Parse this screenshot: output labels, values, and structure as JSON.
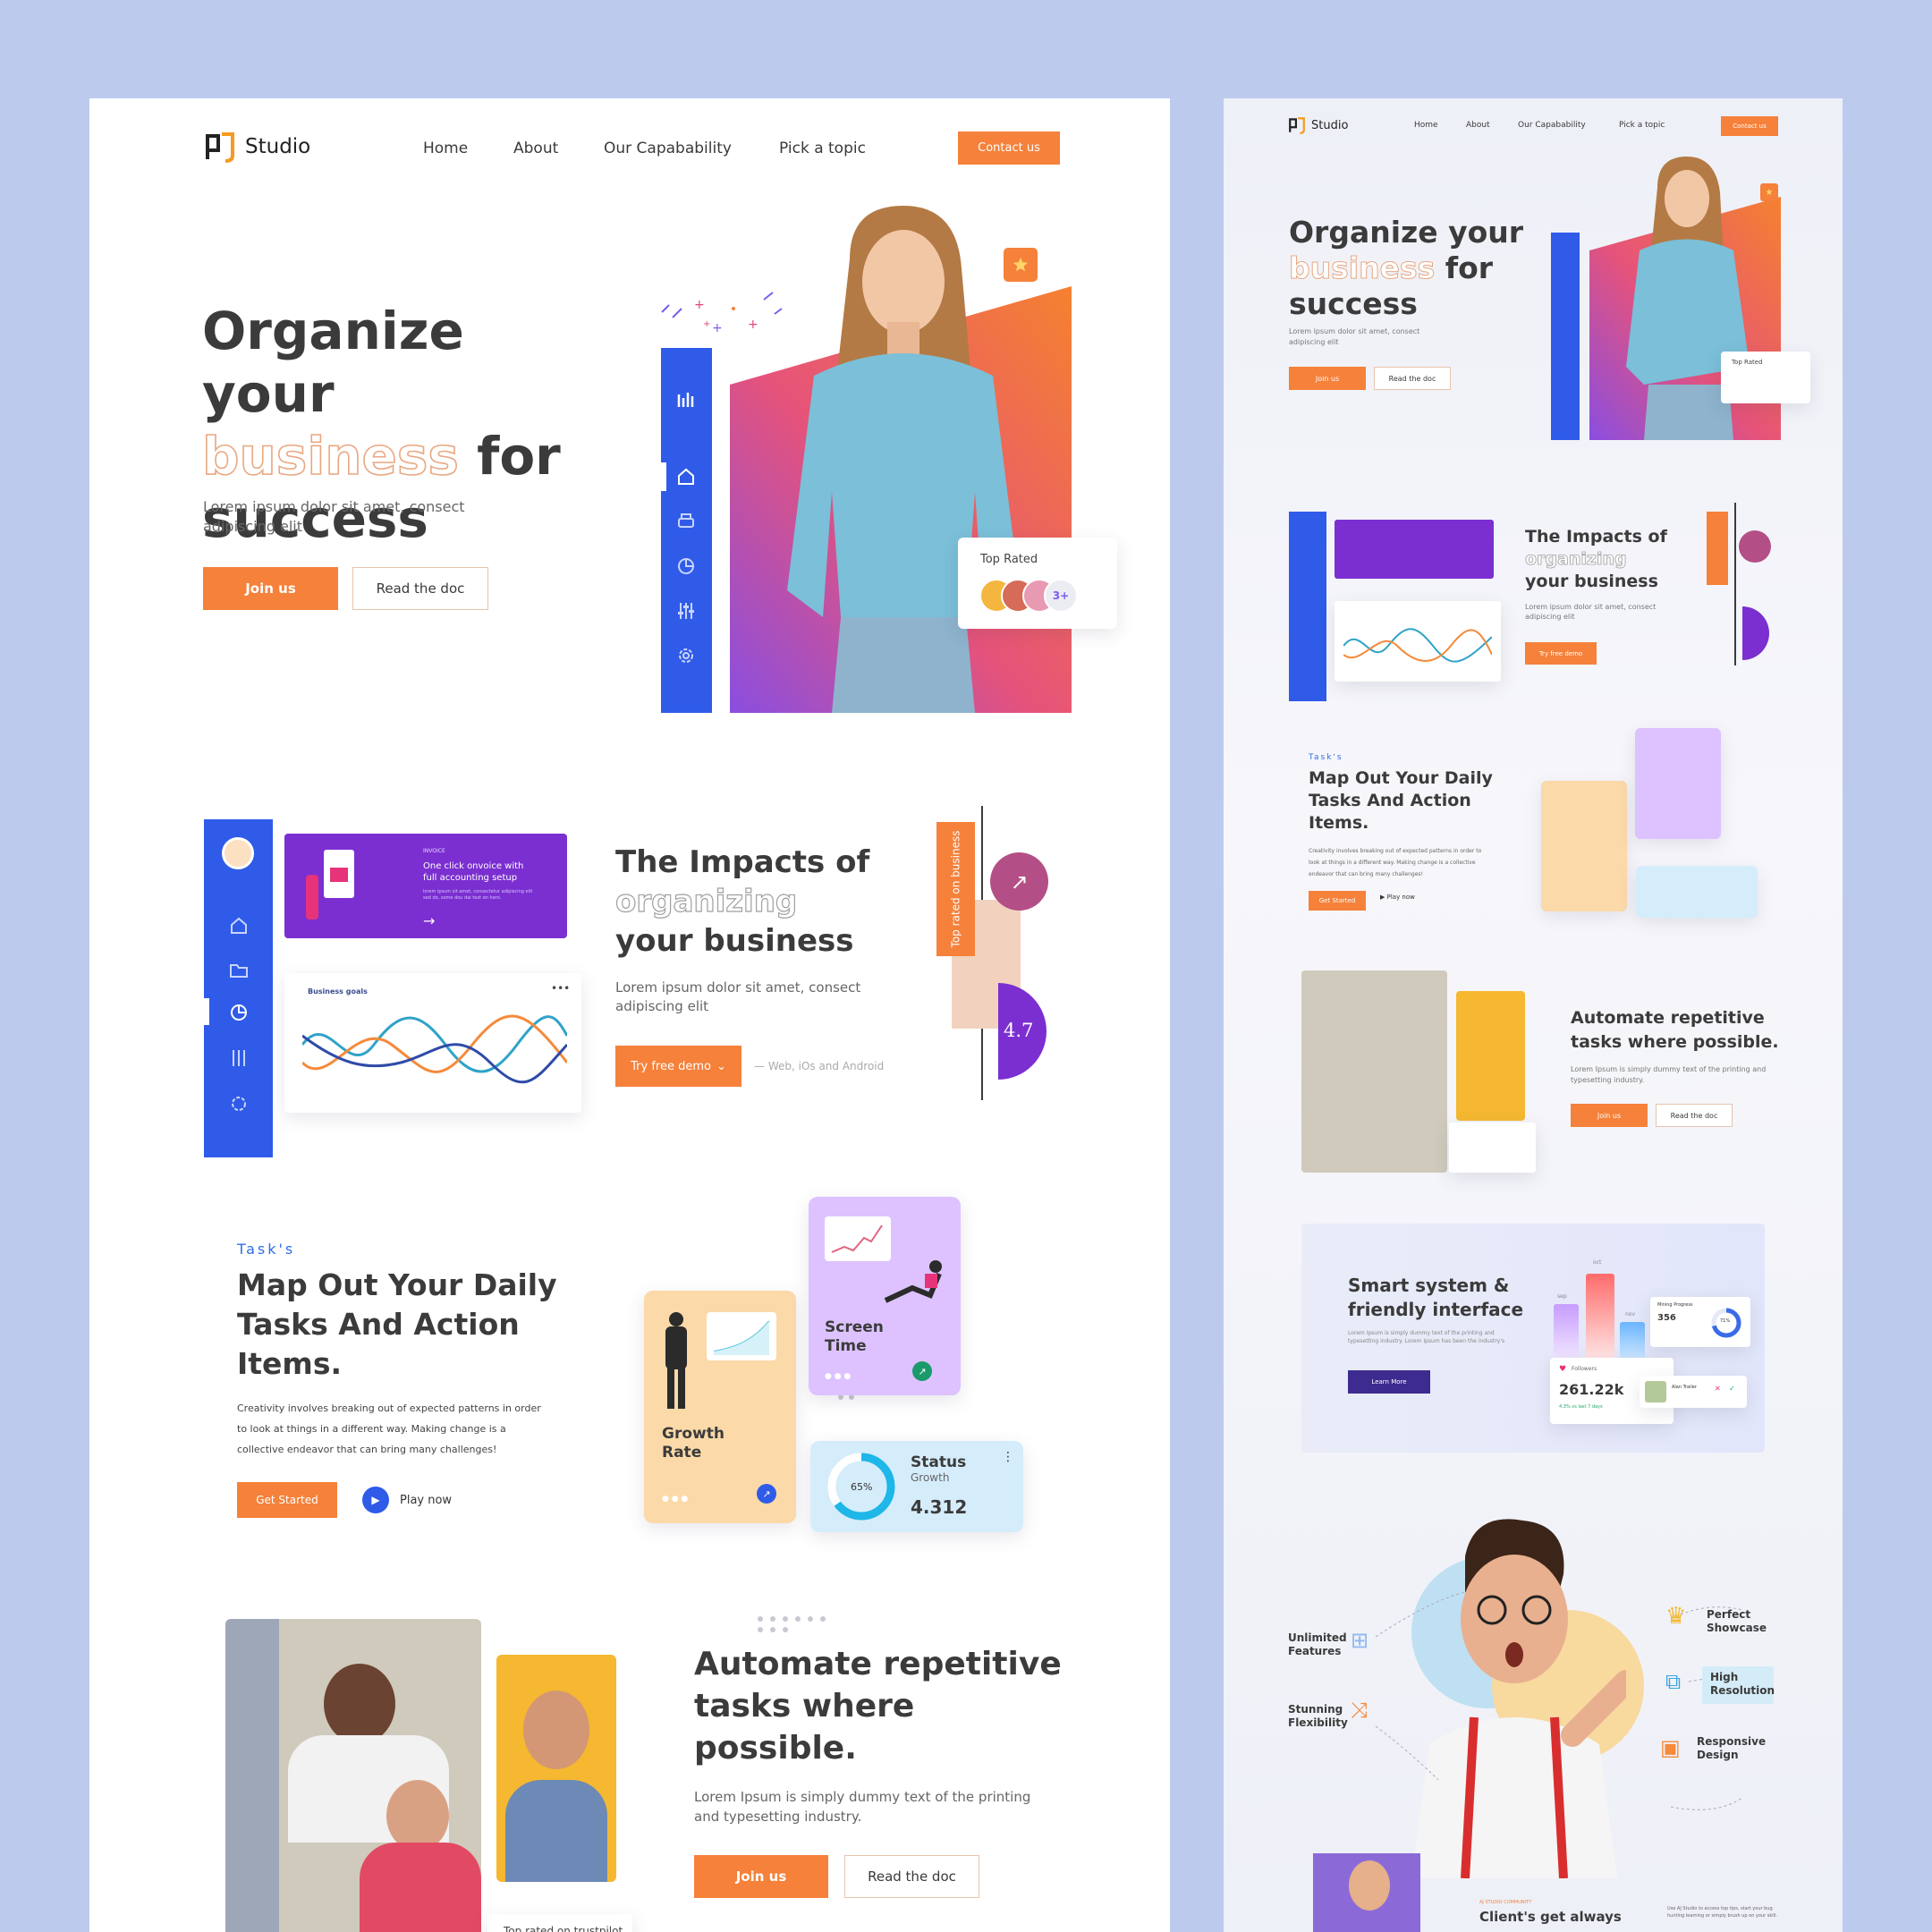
{
  "brand": {
    "name": "Studio",
    "logo_letters": "AJ"
  },
  "nav": {
    "items": [
      "Home",
      "About",
      "Our Capabability",
      "Pick a topic"
    ],
    "contact": "Contact us"
  },
  "hero": {
    "title_line1": "Organize your",
    "title_outline": "business",
    "title_for": "for",
    "title_line3": "success",
    "subtitle": "Lorem ipsum dolor sit amet, consect adipiscing elit",
    "join": "Join us",
    "read": "Read the doc",
    "top_rated": "Top Rated",
    "avatars_more": "3+"
  },
  "impacts": {
    "title_line1": "The Impacts of",
    "title_outline": "organizing",
    "title_line3": "your business",
    "subtitle": "Lorem ipsum dolor sit amet, consect adipiscing elit",
    "cta": "Try free demo",
    "platforms": "— Web, iOs and Android",
    "vertical_tag": "Top rated on business",
    "rating": "4.7",
    "invoice_small": "INVOICE",
    "invoice_text": "One click onvoice with full accounting setup",
    "invoice_sub": "lorem ipsum sit amet, consectetur adipiscing elit sed do, some dou dai text en hero.",
    "goals_label": "Business goals"
  },
  "tasks": {
    "kicker": "Task's",
    "title": "Map Out Your Daily Tasks And Action Items.",
    "body": "Creativity involves breaking out of expected patterns in order to look at things in a different way. Making change is a collective endeavor that can bring many challenges!",
    "cta": "Get Started",
    "play": "Play now",
    "growth": "Growth Rate",
    "screen": "Screen Time",
    "status_title": "Status",
    "status_sub": "Growth",
    "status_value": "4.312",
    "status_percent": "65%"
  },
  "automate": {
    "title": "Automate repetitive tasks where possible.",
    "body": "Lorem Ipsum is simply dummy text of the printing and typesetting industry.",
    "join": "Join us",
    "read": "Read the doc",
    "trust": "Top rated on trustpilot"
  },
  "smart": {
    "title": "Smart system & friendly interface",
    "body": "Lorem Ipsum is simply dummy text of the printing and typesetting industry. Lorem Ipsum has been the industry's",
    "cta": "Learn More",
    "followers_label": "Followers",
    "followers_value": "261.22k",
    "followers_change": "4.3% vs last 7 days",
    "mining_label": "Mining Progress",
    "mining_value": "356",
    "mining_pct": "71%",
    "months": [
      "sep",
      "oct",
      "nov"
    ],
    "profile_name": "Alan Trailer"
  },
  "features": [
    "Unlimited Features",
    "Stunning Flexibility",
    "Perfect Showcase",
    "High Resolution",
    "Responsive Design"
  ],
  "footer_peek": {
    "kicker": "AJ STUDIO COMMUNITY",
    "title": "Client's get always",
    "note": "Use AJ Studio to access top tips, start your bug hunting learning or simply brush up on your skill."
  },
  "colors": {
    "accent": "#f5813a",
    "blue": "#2f5be8",
    "purple": "#7b2fd0",
    "bg": "#bccbed"
  }
}
